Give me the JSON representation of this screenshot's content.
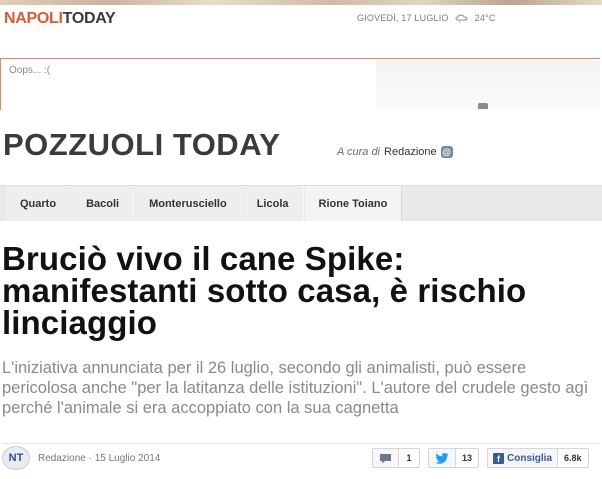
{
  "site": {
    "logo_part1": "NAPOLI",
    "logo_part2": "TODAY",
    "date": "GIOVEDÌ, 17 LUGLIO",
    "temperature": "24°C",
    "weather_icon": "cloud-rain-icon"
  },
  "ad": {
    "message": "Oops... :("
  },
  "section": {
    "title": "POZZUOLI TODAY",
    "curated_prefix": "A cura di",
    "curator": "Redazione",
    "at_symbol": "@"
  },
  "nav": {
    "items": [
      {
        "label": "Quarto"
      },
      {
        "label": "Bacoli"
      },
      {
        "label": "Monterusciello"
      },
      {
        "label": "Licola"
      },
      {
        "label": "Rione Toiano"
      }
    ]
  },
  "article": {
    "headline": "Bruciò vivo il cane Spike: manifestanti sotto casa, è rischio linciaggio",
    "summary": "L'iniziativa annunciata per il 26 luglio, secondo gli animalisti, può essere pericolosa anche \"per la latitanza delle istituzioni\". L'autore del crudele gesto agì perché l'animale si era accoppiato con la sua cagnetta",
    "author_initials": "NT",
    "byline": "Redazione · 15 Luglio 2014"
  },
  "social": {
    "comments_count": "1",
    "twitter_count": "13",
    "facebook_label": "Consiglia",
    "facebook_count": "6.8k"
  },
  "colors": {
    "brand_orange": "#e0582e",
    "facebook_blue": "#3b5998",
    "twitter_blue": "#1da1f2"
  }
}
